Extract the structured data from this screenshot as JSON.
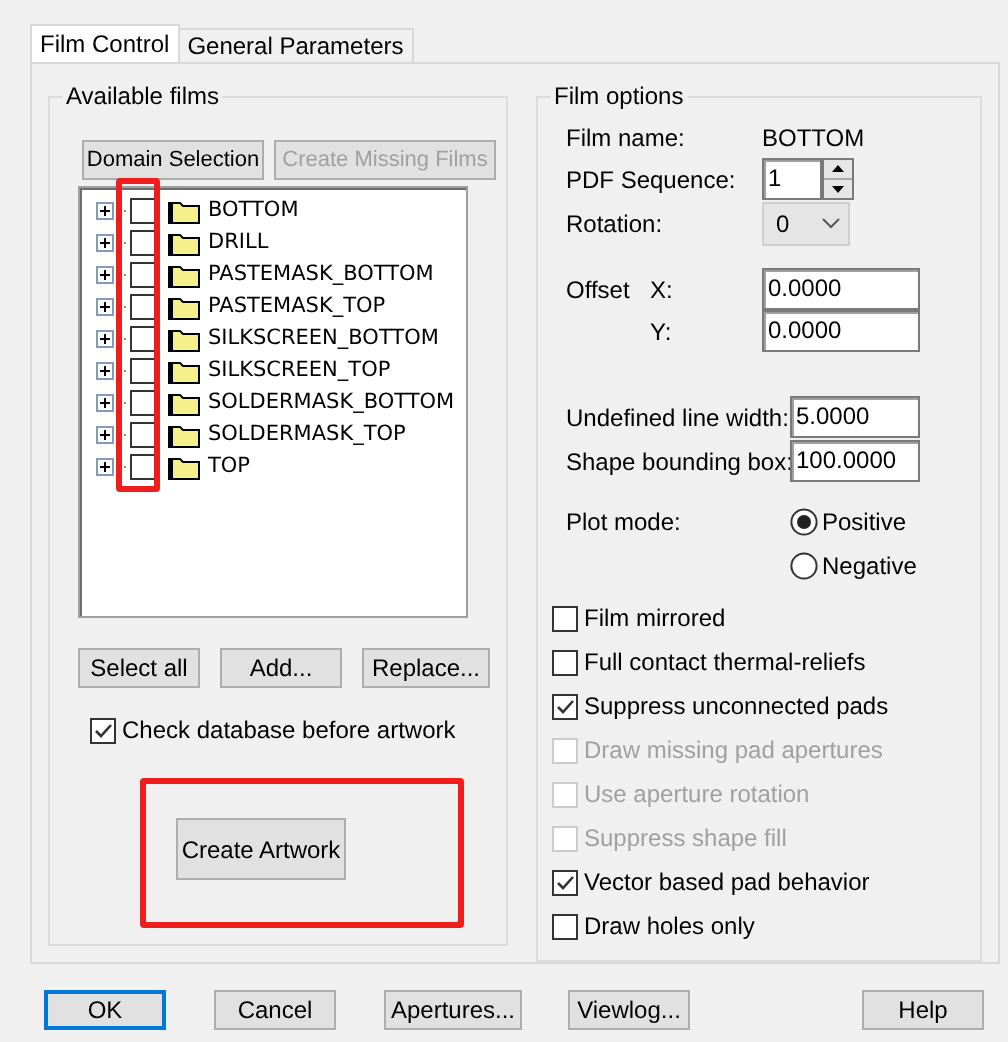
{
  "tabs": [
    {
      "label": "Film Control",
      "selected": true
    },
    {
      "label": "General Parameters",
      "selected": false
    }
  ],
  "available_films": {
    "title": "Available films",
    "buttons": [
      {
        "label": "Domain Selection",
        "disabled": false
      },
      {
        "label": "Create Missing Films",
        "disabled": true
      }
    ],
    "films_highlighted": true,
    "films": [
      {
        "name": "BOTTOM",
        "checked": false,
        "expanded": false
      },
      {
        "name": "DRILL",
        "checked": false,
        "expanded": false
      },
      {
        "name": "PASTEMASK_BOTTOM",
        "checked": false,
        "expanded": false
      },
      {
        "name": "PASTEMASK_TOP",
        "checked": false,
        "expanded": false
      },
      {
        "name": "SILKSCREEN_BOTTOM",
        "checked": false,
        "expanded": false
      },
      {
        "name": "SILKSCREEN_TOP",
        "checked": false,
        "expanded": false
      },
      {
        "name": "SOLDERMASK_BOTTOM",
        "checked": false,
        "expanded": false
      },
      {
        "name": "SOLDERMASK_TOP",
        "checked": false,
        "expanded": false
      },
      {
        "name": "TOP",
        "checked": false,
        "expanded": false
      }
    ],
    "list_buttons": [
      "Select all",
      "Add...",
      "Replace..."
    ],
    "check_database": {
      "label": "Check database before artwork",
      "checked": true
    },
    "create_button": {
      "label": "Create Artwork",
      "highlighted": true
    }
  },
  "film_options": {
    "title": "Film options",
    "film_name": {
      "label": "Film name:",
      "value": "BOTTOM"
    },
    "pdf_sequence": {
      "label": "PDF Sequence:",
      "value": "1"
    },
    "rotation": {
      "label": "Rotation:",
      "value": "0"
    },
    "offset": {
      "label": "Offset",
      "x_label": "X:",
      "x_value": "0.0000",
      "y_label": "Y:",
      "y_value": "0.0000"
    },
    "undefined_line_width": {
      "label": "Undefined line width:",
      "value": "5.0000"
    },
    "shape_bounding_box": {
      "label": "Shape bounding box:",
      "value": "100.0000"
    },
    "plot_mode": {
      "label": "Plot mode:",
      "options": [
        {
          "label": "Positive",
          "selected": true
        },
        {
          "label": "Negative",
          "selected": false
        }
      ]
    },
    "checkboxes": [
      {
        "label": "Film mirrored",
        "checked": false,
        "disabled": false
      },
      {
        "label": "Full contact thermal-reliefs",
        "checked": false,
        "disabled": false
      },
      {
        "label": "Suppress unconnected pads",
        "checked": true,
        "disabled": false
      },
      {
        "label": "Draw missing pad apertures",
        "checked": false,
        "disabled": true
      },
      {
        "label": "Use aperture rotation",
        "checked": false,
        "disabled": true
      },
      {
        "label": "Suppress shape fill",
        "checked": false,
        "disabled": true
      },
      {
        "label": "Vector based pad behavior",
        "checked": true,
        "disabled": false
      },
      {
        "label": "Draw holes only",
        "checked": false,
        "disabled": false
      }
    ]
  },
  "footer_buttons": [
    {
      "label": "OK",
      "default": true
    },
    {
      "label": "Cancel",
      "default": false
    },
    {
      "label": "Apertures...",
      "default": false
    },
    {
      "label": "Viewlog...",
      "default": false
    },
    {
      "label": "Help",
      "default": false
    }
  ]
}
